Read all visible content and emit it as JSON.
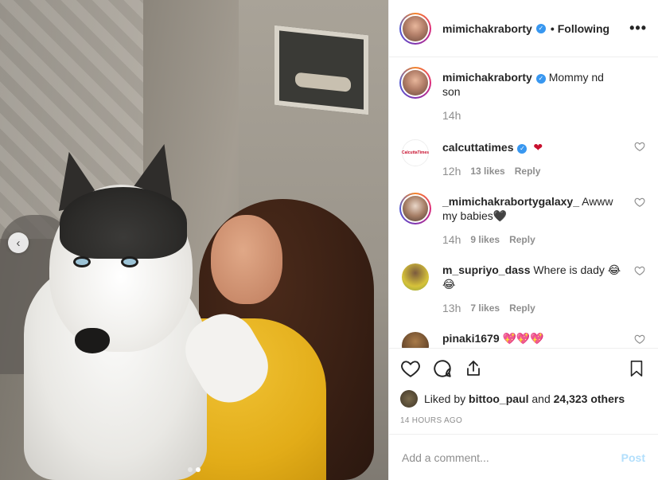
{
  "header": {
    "username": "mimichakraborty",
    "separator": "•",
    "follow_status": "Following",
    "more_label": "•••"
  },
  "photo": {
    "carousel_prev_label": "‹",
    "slide_count": 2,
    "active_slide": 2
  },
  "caption": {
    "username": "mimichakraborty",
    "text": "Mommy nd son",
    "time": "14h"
  },
  "comments": [
    {
      "username": "calcuttatimes",
      "verified": true,
      "text": "❤",
      "time": "12h",
      "likes": "13 likes",
      "reply": "Reply",
      "avatar_text": "CalcuttaTimes"
    },
    {
      "username": "_mimichakrabortygalaxy_",
      "verified": false,
      "text": "Awww my babies🖤",
      "time": "14h",
      "likes": "9 likes",
      "reply": "Reply"
    },
    {
      "username": "m_supriyo_dass",
      "verified": false,
      "text": "Where is dady 😂😂",
      "time": "13h",
      "likes": "7 likes",
      "reply": "Reply"
    },
    {
      "username": "pinaki1679",
      "verified": false,
      "text": "💖💖💖",
      "time": "",
      "likes": "",
      "reply": ""
    }
  ],
  "likes": {
    "prefix": "Liked by",
    "user": "bittoo_paul",
    "mid": "and",
    "others": "24,323 others"
  },
  "timestamp": "14 HOURS AGO",
  "add_comment": {
    "placeholder": "Add a comment...",
    "post_label": "Post"
  },
  "icons": {
    "like": "heart-icon",
    "comment": "comment-icon",
    "share": "share-icon",
    "save": "bookmark-icon",
    "verified": "verified-badge-icon"
  },
  "colors": {
    "verified_blue": "#3897f0",
    "post_disabled": "#b2dffc",
    "muted_text": "#8e8e8e",
    "text": "#262626"
  }
}
